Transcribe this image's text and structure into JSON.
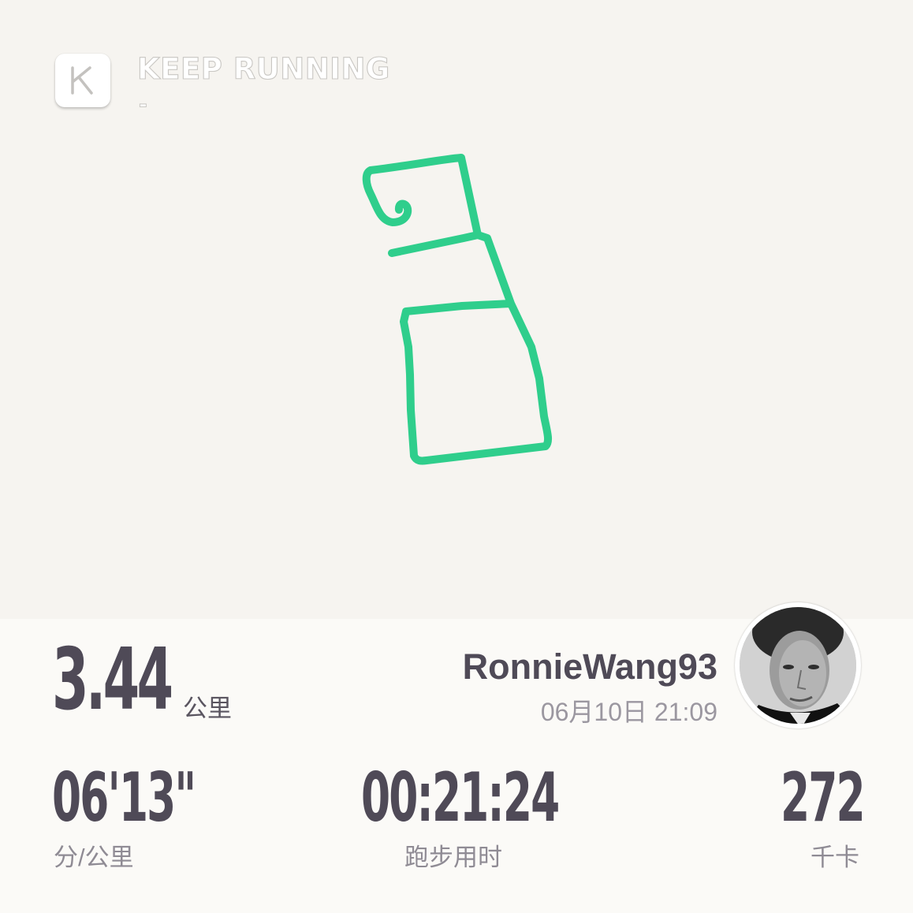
{
  "brand": {
    "title": "KEEP RUNNING",
    "subtitle": "-",
    "logo_icon": "keep-k-logo-icon"
  },
  "route": {
    "color": "#2fce8c"
  },
  "summary": {
    "distance_value": "3.44",
    "distance_unit": "公里",
    "username": "RonnieWang93",
    "datetime": "06月10日 21:09",
    "avatar_icon": "user-avatar-photo"
  },
  "stats": [
    {
      "value": "06'13\"",
      "label": "分/公里"
    },
    {
      "value": "00:21:24",
      "label": "跑步用时"
    },
    {
      "value": "272",
      "label": "千卡"
    }
  ],
  "colors": {
    "text_primary": "#4f4a57",
    "text_secondary": "#8f8b94",
    "background": "#f6f4f0"
  }
}
